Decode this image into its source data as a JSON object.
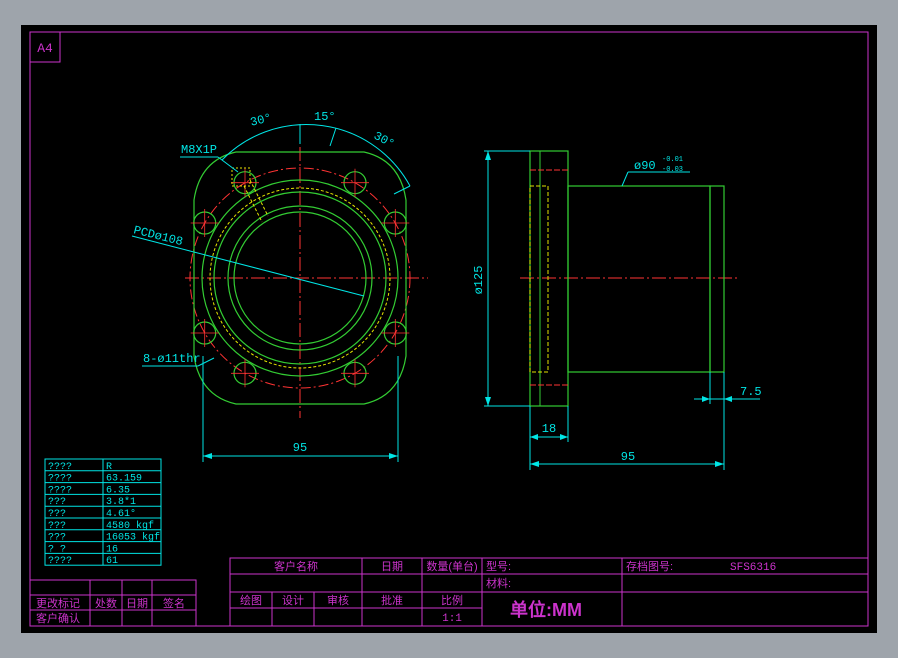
{
  "sheet": {
    "size_label": "A4"
  },
  "colors": {
    "background": "#000000",
    "frame": "#cc33cc",
    "cyan": "#00e5e5",
    "green": "#33cc33",
    "yellow": "#e5e500",
    "red": "#ff3333",
    "white": "#ffffff"
  },
  "front_view": {
    "angle_left": "30°",
    "angle_mid": "15°",
    "angle_right": "30°",
    "thread_label": "M8X1P",
    "pcd_label": "PCDø108",
    "holes_label": "8-ø11thr",
    "width_dim": "95"
  },
  "side_view": {
    "shaft_dia_label": "ø90",
    "tol_upper": "-0.01",
    "tol_lower": "-0.03",
    "flange_dia_dim": "ø125",
    "flange_thick_dim": "18",
    "length_dim": "95",
    "end_dim": "7.5"
  },
  "spec_table": {
    "rows": [
      [
        "????",
        "R"
      ],
      [
        "????",
        "63.159"
      ],
      [
        "????",
        "6.35"
      ],
      [
        "???",
        "3.8*1"
      ],
      [
        "???",
        "4.61°"
      ],
      [
        "???",
        "4580 kgf"
      ],
      [
        "???",
        "16053 kgf"
      ],
      [
        "?  ?",
        "16"
      ],
      [
        "????",
        "61"
      ]
    ]
  },
  "revision_block": {
    "labels": [
      "更改标记",
      "处数",
      "日期",
      "签名"
    ],
    "confirm_label": "客户确认"
  },
  "title_block": {
    "customer_name_label": "客户名称",
    "date_label": "日期",
    "qty_label": "数量(单台)",
    "model_label": "型号:",
    "archive_label": "存档图号:",
    "archive_value": "SFS6316",
    "material_label": "材料:",
    "drawn_label": "绘图",
    "design_label": "设计",
    "review_label": "审核",
    "approve_label": "批准",
    "scale_label": "比例",
    "scale_value": "1:1",
    "unit_label": "单位:MM"
  }
}
